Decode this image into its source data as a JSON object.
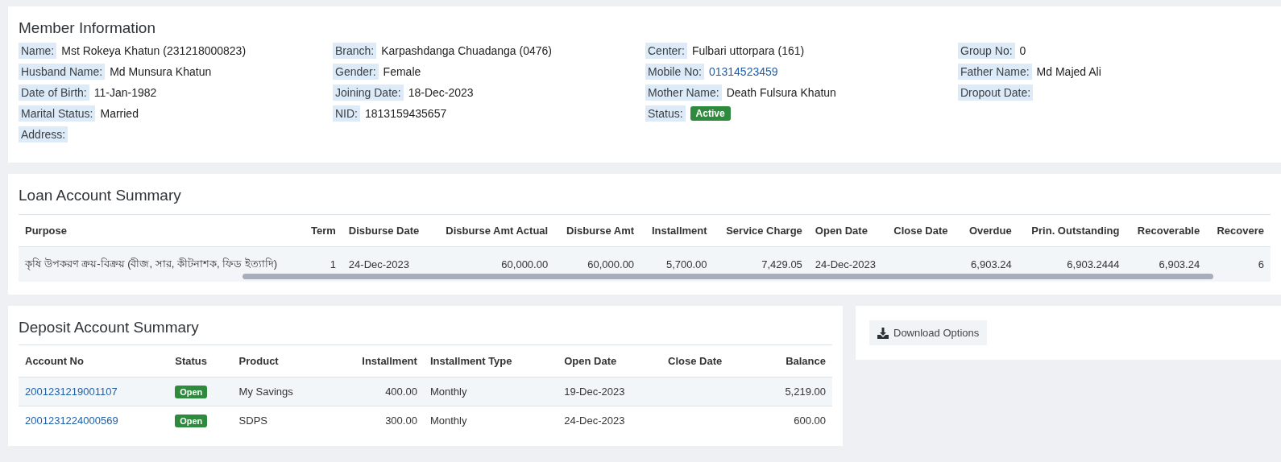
{
  "member_information": {
    "title": "Member Information",
    "columns": [
      [
        {
          "label": "Name:",
          "value": "Mst Rokeya Khatun (231218000823)",
          "kind": "text"
        },
        {
          "label": "Husband Name:",
          "value": "Md Munsura Khatun",
          "kind": "text"
        },
        {
          "label": "Date of Birth:",
          "value": "11-Jan-1982",
          "kind": "text"
        },
        {
          "label": "Marital Status:",
          "value": "Married",
          "kind": "text"
        },
        {
          "label": "Address:"
        }
      ],
      [
        {
          "label": "Branch:",
          "value": "Karpashdanga Chuadanga (0476)",
          "kind": "text"
        },
        {
          "label": "Gender:",
          "value": "Female",
          "kind": "text"
        },
        {
          "label": "Joining Date:",
          "value": "18-Dec-2023",
          "kind": "text"
        },
        {
          "label": "NID:",
          "value": "1813159435657",
          "kind": "text"
        }
      ],
      [
        {
          "label": "Center:",
          "value": "Fulbari uttorpara (161)",
          "kind": "text"
        },
        {
          "label": "Mobile No:",
          "value": "01314523459",
          "kind": "link"
        },
        {
          "label": "Mother Name:",
          "value": "Death Fulsura Khatun",
          "kind": "text"
        },
        {
          "label": "Status:",
          "value": "Active",
          "kind": "badge",
          "color": "#2e8b3e"
        }
      ],
      [
        {
          "label": "Group No:",
          "value": "0",
          "kind": "text"
        },
        {
          "label": "Father Name:",
          "value": "Md Majed Ali",
          "kind": "text"
        },
        {
          "label": "Dropout Date:"
        }
      ]
    ]
  },
  "loan_account_summary": {
    "title": "Loan Account Summary",
    "columns": [
      "Purpose",
      "Term",
      "Disburse Date",
      "Disburse Amt Actual",
      "Disburse Amt",
      "Installment",
      "Service Charge",
      "Open Date",
      "Close Date",
      "Overdue",
      "Prin. Outstanding",
      "Recoverable",
      "Recovere"
    ],
    "rows": [
      {
        "cells": [
          "কৃষি উপকরণ ক্রয়-বিক্রয় (বীজ, সার, কীটনাশক, ফিড ইত্যাদি)",
          "1",
          "24-Dec-2023",
          "60,000.00",
          "60,000.00",
          "5,700.00",
          "7,429.05",
          "24-Dec-2023",
          null,
          "6,903.24",
          "6,903.2444",
          "6,903.24",
          "6"
        ]
      }
    ]
  },
  "deposit_account_summary": {
    "title": "Deposit Account Summary",
    "columns": [
      "Account No",
      "Status",
      "Product",
      "Installment",
      "Installment Type",
      "Open Date",
      "Close Date",
      "Balance"
    ],
    "rows": [
      {
        "account_no": "2001231219001107",
        "status": "Open",
        "product": "My Savings",
        "installment": "400.00",
        "installment_type": "Monthly",
        "open_date": "19-Dec-2023",
        "balance": "5,219.00"
      },
      {
        "account_no": "2001231224000569",
        "status": "Open",
        "product": "SDPS",
        "installment": "300.00",
        "installment_type": "Monthly",
        "open_date": "24-Dec-2023",
        "balance": "600.00"
      }
    ]
  },
  "download_options": {
    "label": "Download Options"
  }
}
